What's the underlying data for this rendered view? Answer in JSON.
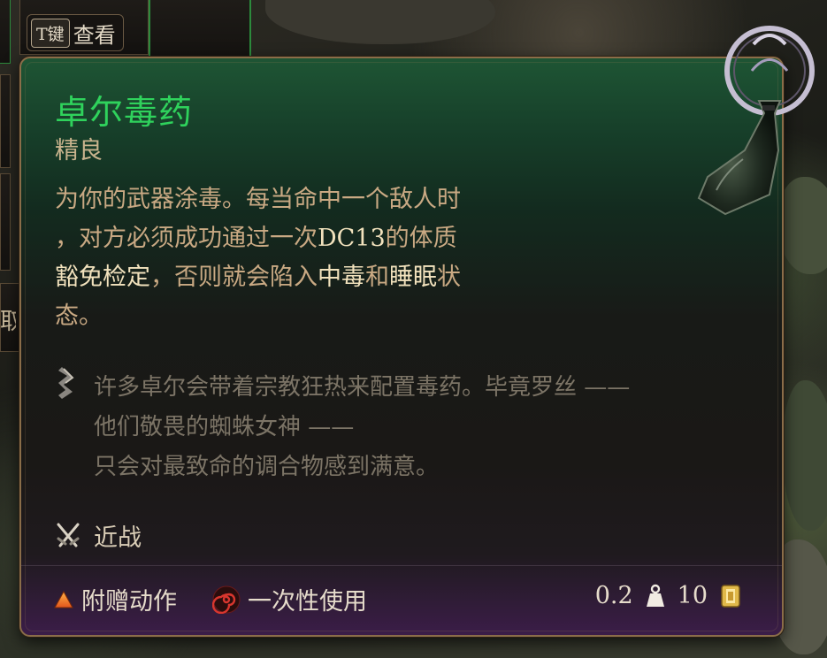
{
  "background": {
    "key_hint": {
      "key": "T键",
      "label": "查看"
    },
    "partial_text": "取"
  },
  "tooltip": {
    "name": "卓尔毒药",
    "rarity": "精良",
    "description": {
      "line1": "为你的武器涂毒。每当命中一个敌人时",
      "line2a": "，对方必须成功通过一次",
      "line2b": "DC13",
      "line2c": "的体质",
      "line3a": "豁免检定",
      "line3b": "，否则就会陷入",
      "line3c": "中毒",
      "line3d": "和",
      "line3e": "睡眠",
      "line3f": "状",
      "line4": "态。"
    },
    "lore": [
      "许多卓尔会带着宗教狂热来配置毒药。毕竟罗丝 ——",
      "他们敬畏的蜘蛛女神 ——",
      "只会对最致命的调合物感到满意。"
    ],
    "weapon_type": "近战",
    "footer": {
      "action_type": "附赠动作",
      "usage": "一次性使用",
      "weight": "0.2",
      "value": "10"
    }
  },
  "colors": {
    "name": "#2fd25c",
    "description": "#c9a983",
    "highlight": "#f2e2bd",
    "lore": "#7c7466",
    "border": "#8a6d49"
  },
  "icons": {
    "lore": "book-quote-icon",
    "weapon": "crossed-swords-icon",
    "action": "orange-triangle-icon",
    "usage": "red-spiral-icon",
    "weight": "weight-icon",
    "value": "gold-coin-icon",
    "item": "poison-potion-bottle-icon"
  }
}
